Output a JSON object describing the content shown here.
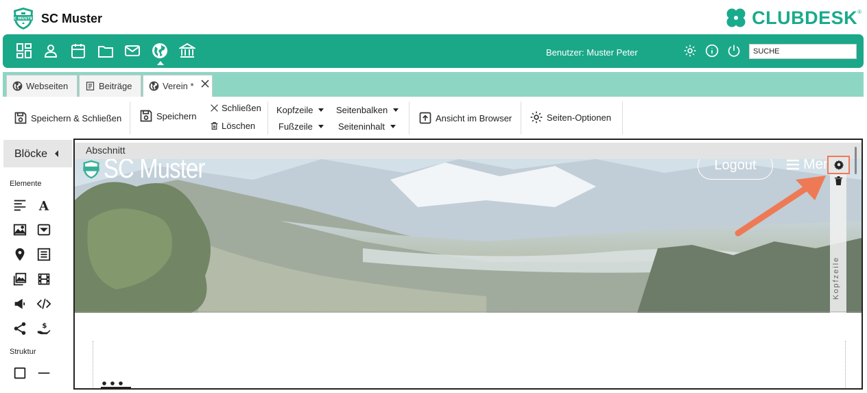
{
  "header": {
    "club_name": "SC Muster",
    "brand_name": "CLUBDESK",
    "brand_reg": "®",
    "logo_icon": "club-shield-logo",
    "brand_icon": "clover-icon"
  },
  "nav": {
    "icons": [
      "dashboard-icon",
      "person-icon",
      "calendar-icon",
      "folder-icon",
      "mail-icon",
      "globe-icon",
      "bank-icon"
    ],
    "active": "globe-icon",
    "user_label": "Benutzer: Muster Peter",
    "right_icons": [
      "settings-icon",
      "info-icon",
      "power-icon"
    ],
    "search_placeholder": "SUCHE"
  },
  "tabs": [
    {
      "label": "Webseiten",
      "icon": "globe-icon",
      "active": false
    },
    {
      "label": "Beiträge",
      "icon": "document-icon",
      "active": false
    },
    {
      "label": "Verein *",
      "icon": "globe-icon",
      "active": true
    }
  ],
  "toolbar": {
    "save_close": "Speichern & Schließen",
    "save": "Speichern",
    "close": "Schließen",
    "delete": "Löschen",
    "kopfzeile": "Kopfzeile",
    "fusszeile": "Fußzeile",
    "seitenbalken": "Seitenbalken",
    "seiteninhalt": "Seiteninhalt",
    "browser_view": "Ansicht im Browser",
    "page_options": "Seiten-Optionen"
  },
  "blocks": {
    "title": "Blöcke",
    "elements_label": "Elemente",
    "element_icons": [
      "text-align-icon",
      "font-icon",
      "image-icon",
      "dropdown-icon",
      "map-pin-icon",
      "newsletter-icon",
      "gallery-icon",
      "film-icon",
      "megaphone-icon",
      "code-icon",
      "share-icon",
      "donation-icon"
    ],
    "structure_label": "Struktur",
    "structure_icons": [
      "box-icon",
      "divider-icon"
    ]
  },
  "editor": {
    "section_label": "Abschnitt",
    "hero_title": "SC Muster",
    "logout_label": "Logout",
    "menu_label": "Men",
    "side_label": "Kopfzeile"
  },
  "colors": {
    "brand_green": "#1ba889",
    "tab_bar": "#8ed6c4",
    "highlight": "#ee7a55"
  }
}
